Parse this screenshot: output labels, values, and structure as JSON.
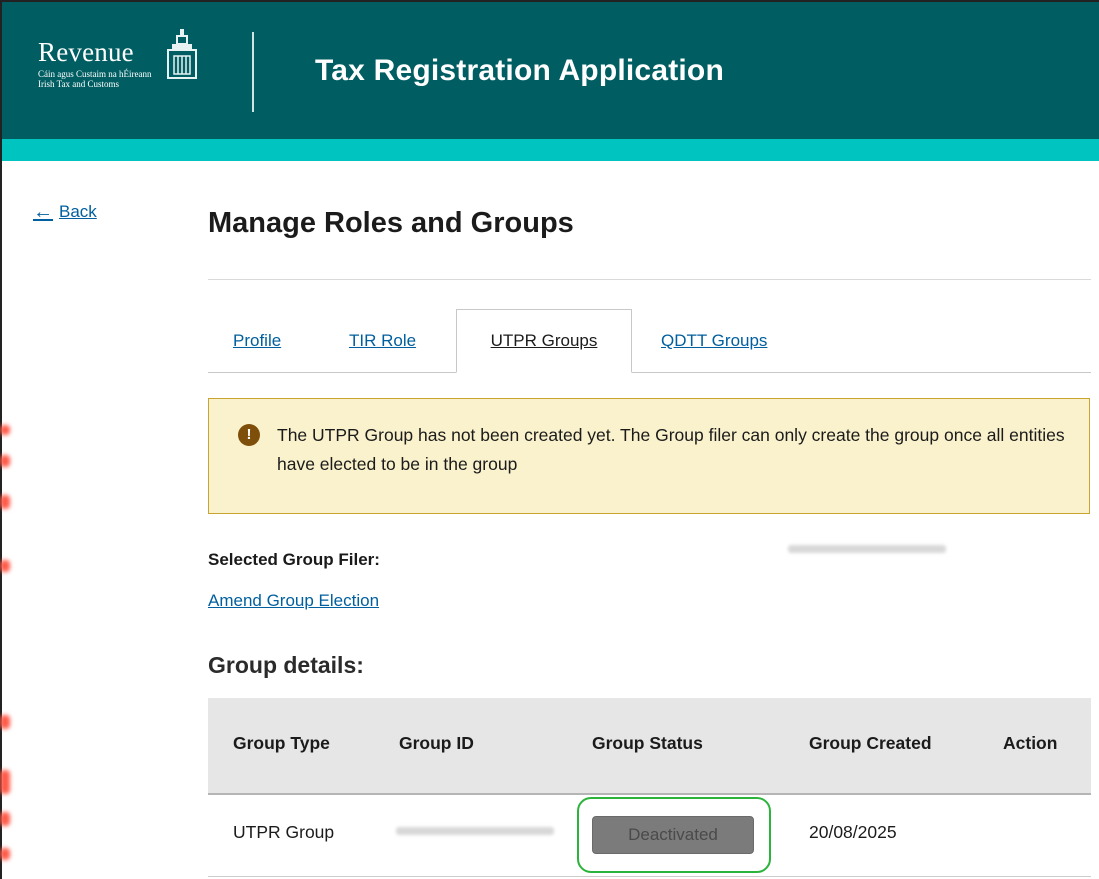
{
  "header": {
    "logo_word": "Revenue",
    "logo_line1": "Cáin agus Custaim na hÉireann",
    "logo_line2": "Irish Tax and Customs",
    "app_title": "Tax Registration Application"
  },
  "back_label": "Back",
  "page_title": "Manage Roles and Groups",
  "tabs": [
    {
      "label": "Profile",
      "active": false
    },
    {
      "label": "TIR Role",
      "active": false
    },
    {
      "label": "UTPR Groups",
      "active": true
    },
    {
      "label": "QDTT Groups",
      "active": false
    }
  ],
  "alert": {
    "icon": "!",
    "text": "The UTPR Group has not been created yet. The Group filer can only create the group once all entities have elected to be in the group"
  },
  "selected_group_filer_label": "Selected Group Filer:",
  "amend_link": "Amend Group Election",
  "group_details_title": "Group details:",
  "table": {
    "headers": [
      "Group Type",
      "Group ID",
      "Group Status",
      "Group Created",
      "Action"
    ],
    "rows": [
      {
        "group_type": "UTPR Group",
        "group_status": "Deactivated",
        "group_created": "20/08/2025",
        "action": ""
      }
    ]
  },
  "colors": {
    "header_bg": "#005e62",
    "accent_band": "#00c4c0",
    "link": "#005f9e",
    "alert_bg": "#f9f2cc",
    "alert_border": "#c9a431",
    "highlight_ring": "#2bb33c"
  }
}
